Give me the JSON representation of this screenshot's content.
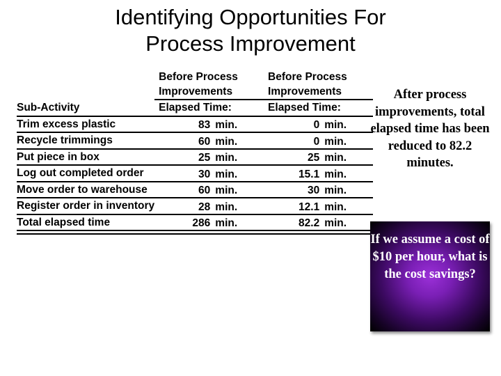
{
  "slide": {
    "title": "Identifying Opportunities For Process Improvement",
    "table": {
      "headers": {
        "sub_activity": "Sub-Activity",
        "before_group_1_line1": "Before Process",
        "before_group_1_line2": "Improvements",
        "before_elapsed_1": "Elapsed Time:",
        "before_group_2_line1": "Before Process",
        "before_group_2_line2": "Improvements",
        "before_elapsed_2": "Elapsed Time:"
      },
      "unit": "min.",
      "rows": [
        {
          "activity": "Trim excess plastic",
          "before": "83",
          "after": "0"
        },
        {
          "activity": "Recycle trimmings",
          "before": "60",
          "after": "0"
        },
        {
          "activity": "Put piece in box",
          "before": "25",
          "after": "25"
        },
        {
          "activity": "Log out completed order",
          "before": "30",
          "after": "15.1"
        },
        {
          "activity": "Move order to warehouse",
          "before": "60",
          "after": "30"
        },
        {
          "activity": "Register order in inventory",
          "before": "28",
          "after": "12.1"
        },
        {
          "activity": "Total elapsed time",
          "before": "286",
          "after": "82.2"
        }
      ]
    },
    "after_note": "After process improvements, total elapsed time has been reduced to 82.2 minutes.",
    "cost_question": "If we assume a cost of $10 per hour, what is the cost savings?",
    "colors": {
      "cost_box_center": "#9b30d8",
      "cost_box_edge": "#000000",
      "text": "#000000"
    }
  }
}
